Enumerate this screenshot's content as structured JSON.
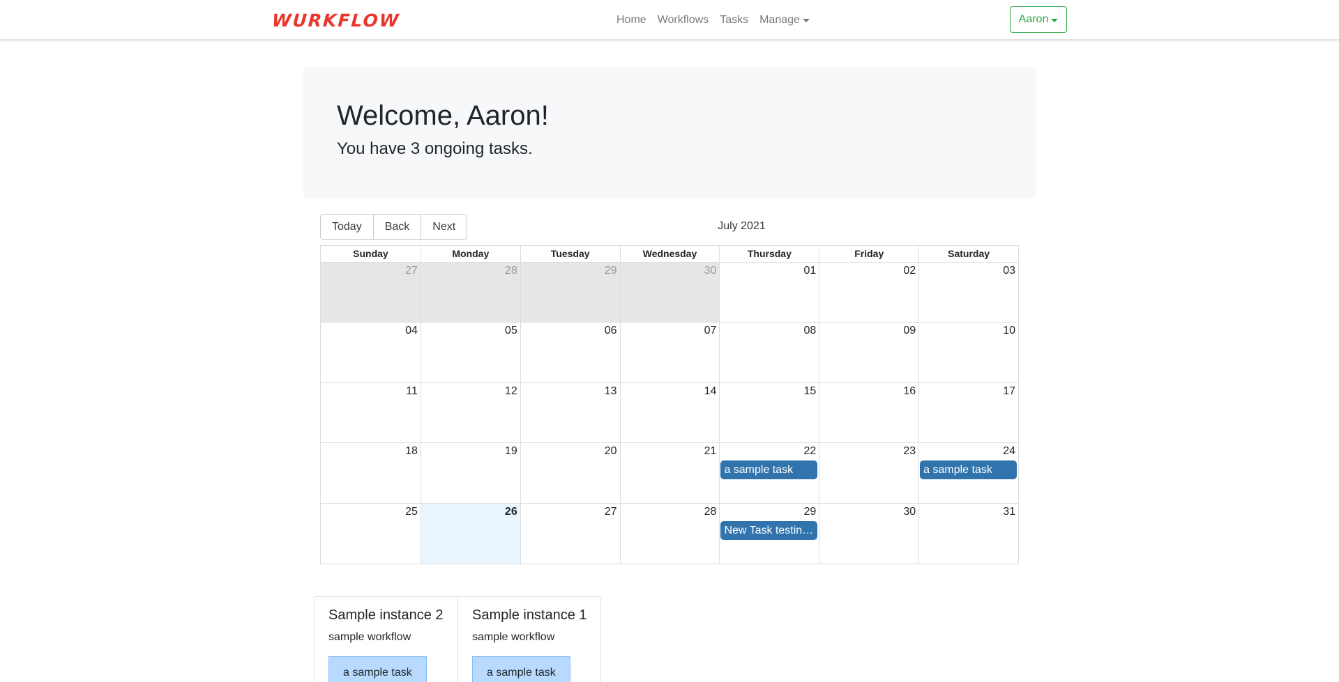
{
  "brand": {
    "logo_text": "WURKFLOW",
    "color": "#e8372d"
  },
  "nav": {
    "links": [
      "Home",
      "Workflows",
      "Tasks"
    ],
    "manage_label": "Manage",
    "user_label": "Aaron",
    "user_color": "#28a745"
  },
  "welcome": {
    "title": "Welcome, Aaron!",
    "subtitle": "You have 3 ongoing tasks."
  },
  "calendar": {
    "buttons": [
      "Today",
      "Back",
      "Next"
    ],
    "label": "July 2021",
    "weekdays": [
      "Sunday",
      "Monday",
      "Tuesday",
      "Wednesday",
      "Thursday",
      "Friday",
      "Saturday"
    ],
    "weeks": [
      [
        {
          "d": "27",
          "off": true
        },
        {
          "d": "28",
          "off": true
        },
        {
          "d": "29",
          "off": true
        },
        {
          "d": "30",
          "off": true
        },
        {
          "d": "01"
        },
        {
          "d": "02"
        },
        {
          "d": "03"
        }
      ],
      [
        {
          "d": "04"
        },
        {
          "d": "05"
        },
        {
          "d": "06"
        },
        {
          "d": "07"
        },
        {
          "d": "08"
        },
        {
          "d": "09"
        },
        {
          "d": "10"
        }
      ],
      [
        {
          "d": "11"
        },
        {
          "d": "12"
        },
        {
          "d": "13"
        },
        {
          "d": "14"
        },
        {
          "d": "15"
        },
        {
          "d": "16"
        },
        {
          "d": "17"
        }
      ],
      [
        {
          "d": "18"
        },
        {
          "d": "19"
        },
        {
          "d": "20"
        },
        {
          "d": "21"
        },
        {
          "d": "22",
          "event": "a sample task"
        },
        {
          "d": "23"
        },
        {
          "d": "24",
          "event": "a sample task"
        }
      ],
      [
        {
          "d": "25"
        },
        {
          "d": "26",
          "today": true
        },
        {
          "d": "27"
        },
        {
          "d": "28"
        },
        {
          "d": "29",
          "event": "New Task testing..."
        },
        {
          "d": "30"
        },
        {
          "d": "31"
        }
      ]
    ],
    "event_color": "#3174ad"
  },
  "instances": [
    {
      "title": "Sample instance 2",
      "workflow": "sample workflow",
      "task": "a sample task"
    },
    {
      "title": "Sample instance 1",
      "workflow": "sample workflow",
      "task": "a sample task"
    }
  ]
}
